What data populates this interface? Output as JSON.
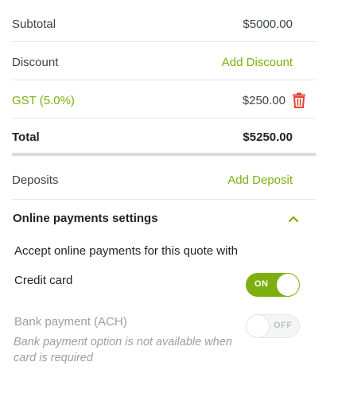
{
  "summary": {
    "subtotal": {
      "label": "Subtotal",
      "value": "$5000.00"
    },
    "discount": {
      "label": "Discount",
      "action": "Add Discount"
    },
    "gst": {
      "label": "GST (5.0%)",
      "value": "$250.00",
      "icon": "trash-icon"
    },
    "total": {
      "label": "Total",
      "value": "$5250.00"
    },
    "deposits": {
      "label": "Deposits",
      "action": "Add Deposit"
    }
  },
  "online_payments": {
    "title": "Online payments settings",
    "collapse_icon": "chevron-up-icon",
    "intro": "Accept online payments for this quote with",
    "credit_card": {
      "label": "Credit card",
      "toggle_label": "ON",
      "enabled": true
    },
    "bank_payment": {
      "label": "Bank payment (ACH)",
      "toggle_label": "OFF",
      "enabled": false,
      "note": "Bank payment option is not available when card is required"
    }
  },
  "colors": {
    "accent": "#7db00e",
    "danger": "#e0452b",
    "muted": "#9a9ea3"
  }
}
